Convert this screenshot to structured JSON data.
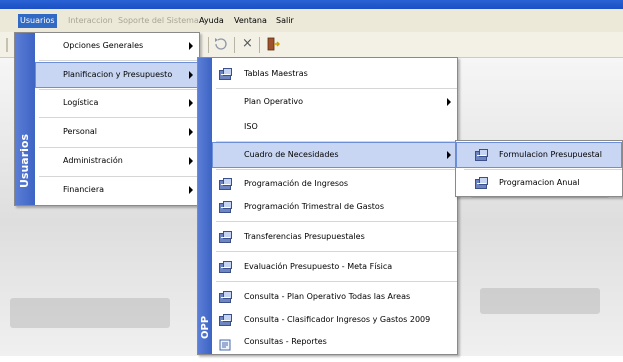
{
  "menubar": {
    "items": [
      {
        "label": "Usuarios",
        "state": "open"
      },
      {
        "label": "Interaccion",
        "state": "disabled"
      },
      {
        "label": "Soporte del Sistema",
        "state": "disabled"
      },
      {
        "label": "Ayuda",
        "state": "normal"
      },
      {
        "label": "Ventana",
        "state": "normal"
      },
      {
        "label": "Salir",
        "state": "normal"
      }
    ]
  },
  "toolbar": {
    "icons": [
      "refresh-icon",
      "close-icon",
      "exit-icon"
    ],
    "close_glyph": "×"
  },
  "usuarios_menu": {
    "side_label": "Usuarios",
    "items": [
      {
        "label": "Opciones Generales",
        "submenu": true
      },
      {
        "label": "Planificacion y Presupuesto",
        "submenu": true,
        "selected": true
      },
      {
        "label": "Logística",
        "submenu": true
      },
      {
        "label": "Personal",
        "submenu": true
      },
      {
        "label": "Administración",
        "submenu": true
      },
      {
        "label": "Financiera",
        "submenu": true
      }
    ]
  },
  "opp_menu": {
    "side_label": "OPP",
    "items": [
      {
        "label": "Tablas Maestras",
        "icon": "form-icon"
      },
      {
        "label": "Plan Operativo",
        "submenu": true
      },
      {
        "label": "ISO"
      },
      {
        "label": "Cuadro de Necesidades",
        "submenu": true,
        "selected": true
      },
      {
        "label": "Programación de Ingresos",
        "icon": "form-icon"
      },
      {
        "label": "Programación Trimestral de Gastos",
        "icon": "form-icon"
      },
      {
        "label": "Transferencias Presupuestales",
        "icon": "form-icon"
      },
      {
        "label": "Evaluación Presupuesto - Meta Física",
        "icon": "form-icon"
      },
      {
        "label": "Consulta - Plan Operativo Todas las Areas",
        "icon": "form-icon"
      },
      {
        "label": "Consulta - Clasificador Ingresos y Gastos 2009",
        "icon": "form-icon"
      },
      {
        "label": "Consultas - Reportes",
        "icon": "report-icon"
      }
    ]
  },
  "cuadro_menu": {
    "items": [
      {
        "label": "Formulacion Presupuestal",
        "icon": "form-icon",
        "selected": true
      },
      {
        "label": "Programacion Anual",
        "icon": "form-icon"
      }
    ]
  },
  "colors": {
    "title_blue": "#2a62d6",
    "menu_highlight": "#c8d6f3",
    "side_strip": "#3d63c4"
  }
}
